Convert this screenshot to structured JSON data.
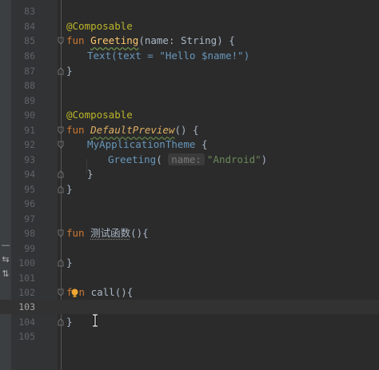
{
  "editor": {
    "lines": [
      {
        "num": "83"
      },
      {
        "num": "84",
        "annotation": "@Composable"
      },
      {
        "num": "85",
        "kw": "fun",
        "name": "Greeting",
        "open": "(",
        "param": "name",
        "colon": ": ",
        "type": "String",
        "close": ") {"
      },
      {
        "num": "86",
        "call": "Text",
        "args_open": "(text = ",
        "str": "\"Hello $name!\"",
        "args_close": ")"
      },
      {
        "num": "87",
        "text": "}"
      },
      {
        "num": "88"
      },
      {
        "num": "89"
      },
      {
        "num": "90",
        "annotation": "@Composable"
      },
      {
        "num": "91",
        "kw": "fun",
        "name": "DefaultPreview",
        "rest": "() {"
      },
      {
        "num": "92",
        "call": "MyApplicationTheme",
        "rest": " {"
      },
      {
        "num": "93",
        "call": "Greeting",
        "open": "(",
        "hint": "name:",
        "str": "\"Android\"",
        "close": ")"
      },
      {
        "num": "94",
        "text": "}"
      },
      {
        "num": "95",
        "text": "}"
      },
      {
        "num": "96"
      },
      {
        "num": "97"
      },
      {
        "num": "98",
        "kw": "fun",
        "name": "测试函数",
        "rest": "(){"
      },
      {
        "num": "99"
      },
      {
        "num": "100",
        "text": "}"
      },
      {
        "num": "101"
      },
      {
        "num": "102",
        "kw_start": "f",
        "kw_end": "n",
        "rest": " call(){"
      },
      {
        "num": "103"
      },
      {
        "num": "104",
        "text": "}"
      },
      {
        "num": "105"
      }
    ]
  },
  "tools": {
    "icon1": "—",
    "icon2": "⇆",
    "icon3": "⇅"
  }
}
